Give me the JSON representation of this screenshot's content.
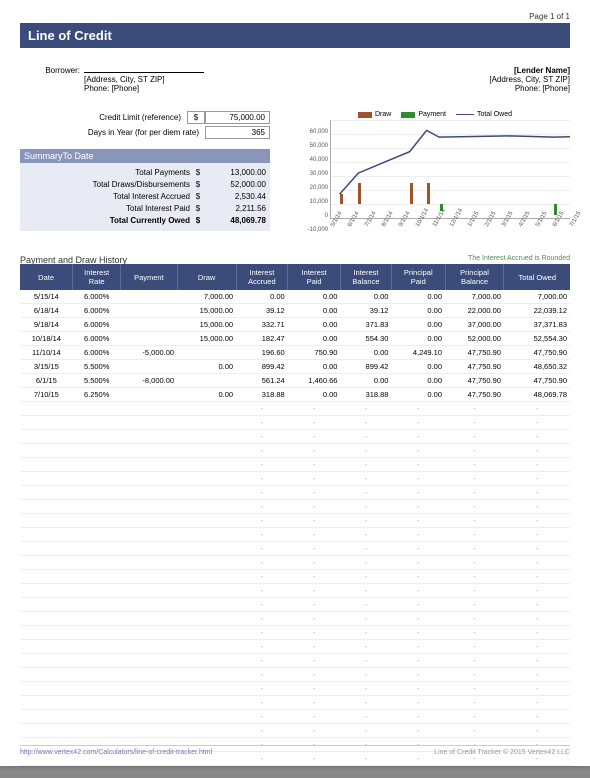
{
  "pageNumber": "Page 1 of 1",
  "title": "Line of Credit",
  "borrower": {
    "label": "Borrower:",
    "address": "[Address, City, ST ZIP]",
    "phone": "Phone: [Phone]"
  },
  "lender": {
    "name": "[Lender Name]",
    "address": "[Address, City, ST  ZIP]",
    "phone": "Phone: [Phone]"
  },
  "ref": {
    "creditLimitLabel": "Credit Limit (reference)",
    "creditLimitCur": "$",
    "creditLimitVal": "75,000.00",
    "daysLabel": "Days in Year (for per diem rate)",
    "daysVal": "365"
  },
  "summary": {
    "header": "SummaryTo Date",
    "rows": [
      {
        "label": "Total Payments",
        "cur": "$",
        "val": "13,000.00"
      },
      {
        "label": "Total Draws/Disbursements",
        "cur": "$",
        "val": "52,000.00"
      },
      {
        "label": "Total Interest Accrued",
        "cur": "$",
        "val": "2,530.44"
      },
      {
        "label": "Total Interest Paid",
        "cur": "$",
        "val": "2,211.56"
      },
      {
        "label": "Total Currently Owed",
        "cur": "$",
        "val": "48,069.78",
        "bold": true
      }
    ]
  },
  "chart_data": {
    "type": "bar+line",
    "legend": [
      "Draw",
      "Payment",
      "Total Owed"
    ],
    "ylabels": [
      "60,000",
      "50,000",
      "40,000",
      "30,000",
      "20,000",
      "10,000",
      "0",
      "-10,000"
    ],
    "ylim": [
      -10000,
      60000
    ],
    "x": [
      "5/1/14",
      "6/1/14",
      "7/1/14",
      "8/1/14",
      "9/1/14",
      "10/1/14",
      "11/1/14",
      "12/1/14",
      "1/1/15",
      "2/1/15",
      "3/1/15",
      "4/1/15",
      "5/1/15",
      "6/1/15",
      "7/1/15"
    ],
    "series": [
      {
        "name": "Draw",
        "type": "bar",
        "color": "#a0522d",
        "points": [
          {
            "x": "5/15/14",
            "v": 7000
          },
          {
            "x": "6/18/14",
            "v": 15000
          },
          {
            "x": "9/18/14",
            "v": 15000
          },
          {
            "x": "10/18/14",
            "v": 15000
          },
          {
            "x": "3/15/15",
            "v": 0
          },
          {
            "x": "7/10/15",
            "v": 0
          }
        ]
      },
      {
        "name": "Payment",
        "type": "bar",
        "color": "#2e8b2e",
        "points": [
          {
            "x": "11/10/14",
            "v": -5000
          },
          {
            "x": "6/1/15",
            "v": -8000
          }
        ]
      },
      {
        "name": "Total Owed",
        "type": "line",
        "color": "#3b4b7a",
        "points": [
          {
            "x": "5/15/14",
            "v": 7000
          },
          {
            "x": "6/18/14",
            "v": 22039
          },
          {
            "x": "9/18/14",
            "v": 37372
          },
          {
            "x": "10/18/14",
            "v": 52554
          },
          {
            "x": "11/10/14",
            "v": 47751
          },
          {
            "x": "3/15/15",
            "v": 48650
          },
          {
            "x": "6/1/15",
            "v": 47751
          },
          {
            "x": "7/10/15",
            "v": 48070
          }
        ]
      }
    ]
  },
  "historyTitle": "Payment and Draw History",
  "note": "The Interest Accrued is Rounded",
  "columns": [
    "Date",
    "Interest\nRate",
    "Payment",
    "Draw",
    "Interest\nAccrued",
    "Interest\nPaid",
    "Interest\nBalance",
    "Principal\nPaid",
    "Principal\nBalance",
    "Total Owed"
  ],
  "rows": [
    {
      "date": "5/15/14",
      "rate": "6.000%",
      "pay": "",
      "draw": "7,000.00",
      "iacc": "0.00",
      "ipaid": "0.00",
      "ibal": "0.00",
      "ppaid": "0.00",
      "pbal": "7,000.00",
      "owed": "7,000.00"
    },
    {
      "date": "6/18/14",
      "rate": "6.000%",
      "pay": "",
      "draw": "15,000.00",
      "iacc": "39.12",
      "ipaid": "0.00",
      "ibal": "39.12",
      "ppaid": "0.00",
      "pbal": "22,000.00",
      "owed": "22,039.12"
    },
    {
      "date": "9/18/14",
      "rate": "6.000%",
      "pay": "",
      "draw": "15,000.00",
      "iacc": "332.71",
      "ipaid": "0.00",
      "ibal": "371.83",
      "ppaid": "0.00",
      "pbal": "37,000.00",
      "owed": "37,371.83"
    },
    {
      "date": "10/18/14",
      "rate": "6.000%",
      "pay": "",
      "draw": "15,000.00",
      "iacc": "182.47",
      "ipaid": "0.00",
      "ibal": "554.30",
      "ppaid": "0.00",
      "pbal": "52,000.00",
      "owed": "52,554.30"
    },
    {
      "date": "11/10/14",
      "rate": "6.000%",
      "pay": "-5,000.00",
      "draw": "",
      "iacc": "196.60",
      "ipaid": "750.90",
      "ibal": "0.00",
      "ppaid": "4,249.10",
      "pbal": "47,750.90",
      "owed": "47,750.90"
    },
    {
      "date": "3/15/15",
      "rate": "5.500%",
      "pay": "",
      "draw": "0.00",
      "iacc": "899.42",
      "ipaid": "0.00",
      "ibal": "899.42",
      "ppaid": "0.00",
      "pbal": "47,750.90",
      "owed": "48,650.32"
    },
    {
      "date": "6/1/15",
      "rate": "5.500%",
      "pay": "-8,000.00",
      "draw": "",
      "iacc": "561.24",
      "ipaid": "1,460.66",
      "ibal": "0.00",
      "ppaid": "0.00",
      "pbal": "47,750.90",
      "owed": "47,750.90"
    },
    {
      "date": "7/10/15",
      "rate": "6.250%",
      "pay": "",
      "draw": "0.00",
      "iacc": "318.88",
      "ipaid": "0.00",
      "ibal": "318.88",
      "ppaid": "0.00",
      "pbal": "47,750.90",
      "owed": "48,069.78"
    }
  ],
  "emptyRows": 26,
  "footer": {
    "url": "http://www.vertex42.com/Calculators/line-of-credit-tracker.html",
    "copyright": "Line of Credit Tracker © 2015 Vertex42 LLC"
  }
}
